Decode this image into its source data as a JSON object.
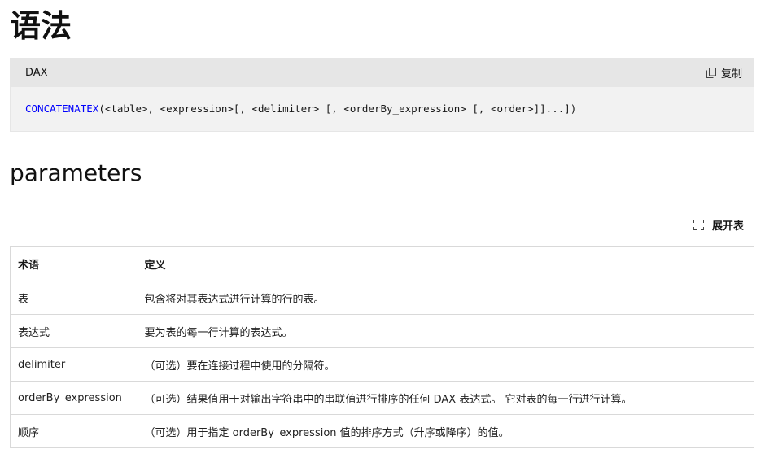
{
  "syntax_heading": "语法",
  "code": {
    "language": "DAX",
    "copy_label": "复制",
    "function_name": "CONCATENATEX",
    "arguments": "(<table>, <expression>[, <delimiter> [, <orderBy_expression> [, <order>]]...])"
  },
  "parameters_heading": "parameters",
  "expand_label": "展开表",
  "table": {
    "headers": [
      "术语",
      "定义"
    ],
    "rows": [
      [
        "表",
        "包含将对其表达式进行计算的行的表。"
      ],
      [
        "表达式",
        "要为表的每一行计算的表达式。"
      ],
      [
        "delimiter",
        "（可选）要在连接过程中使用的分隔符。"
      ],
      [
        "orderBy_expression",
        "（可选）结果值用于对输出字符串中的串联值进行排序的任何 DAX 表达式。 它对表的每一行进行计算。"
      ],
      [
        "顺序",
        "（可选）用于指定 orderBy_expression 值的排序方式（升序或降序）的值。"
      ]
    ]
  },
  "icons": {
    "copy": "copy-icon",
    "expand": "expand-icon"
  },
  "colors": {
    "code_function": "#0101fd",
    "code_background": "#f2f2f2",
    "code_header_background": "#e6e6e6",
    "table_border": "#d9d9d9"
  }
}
